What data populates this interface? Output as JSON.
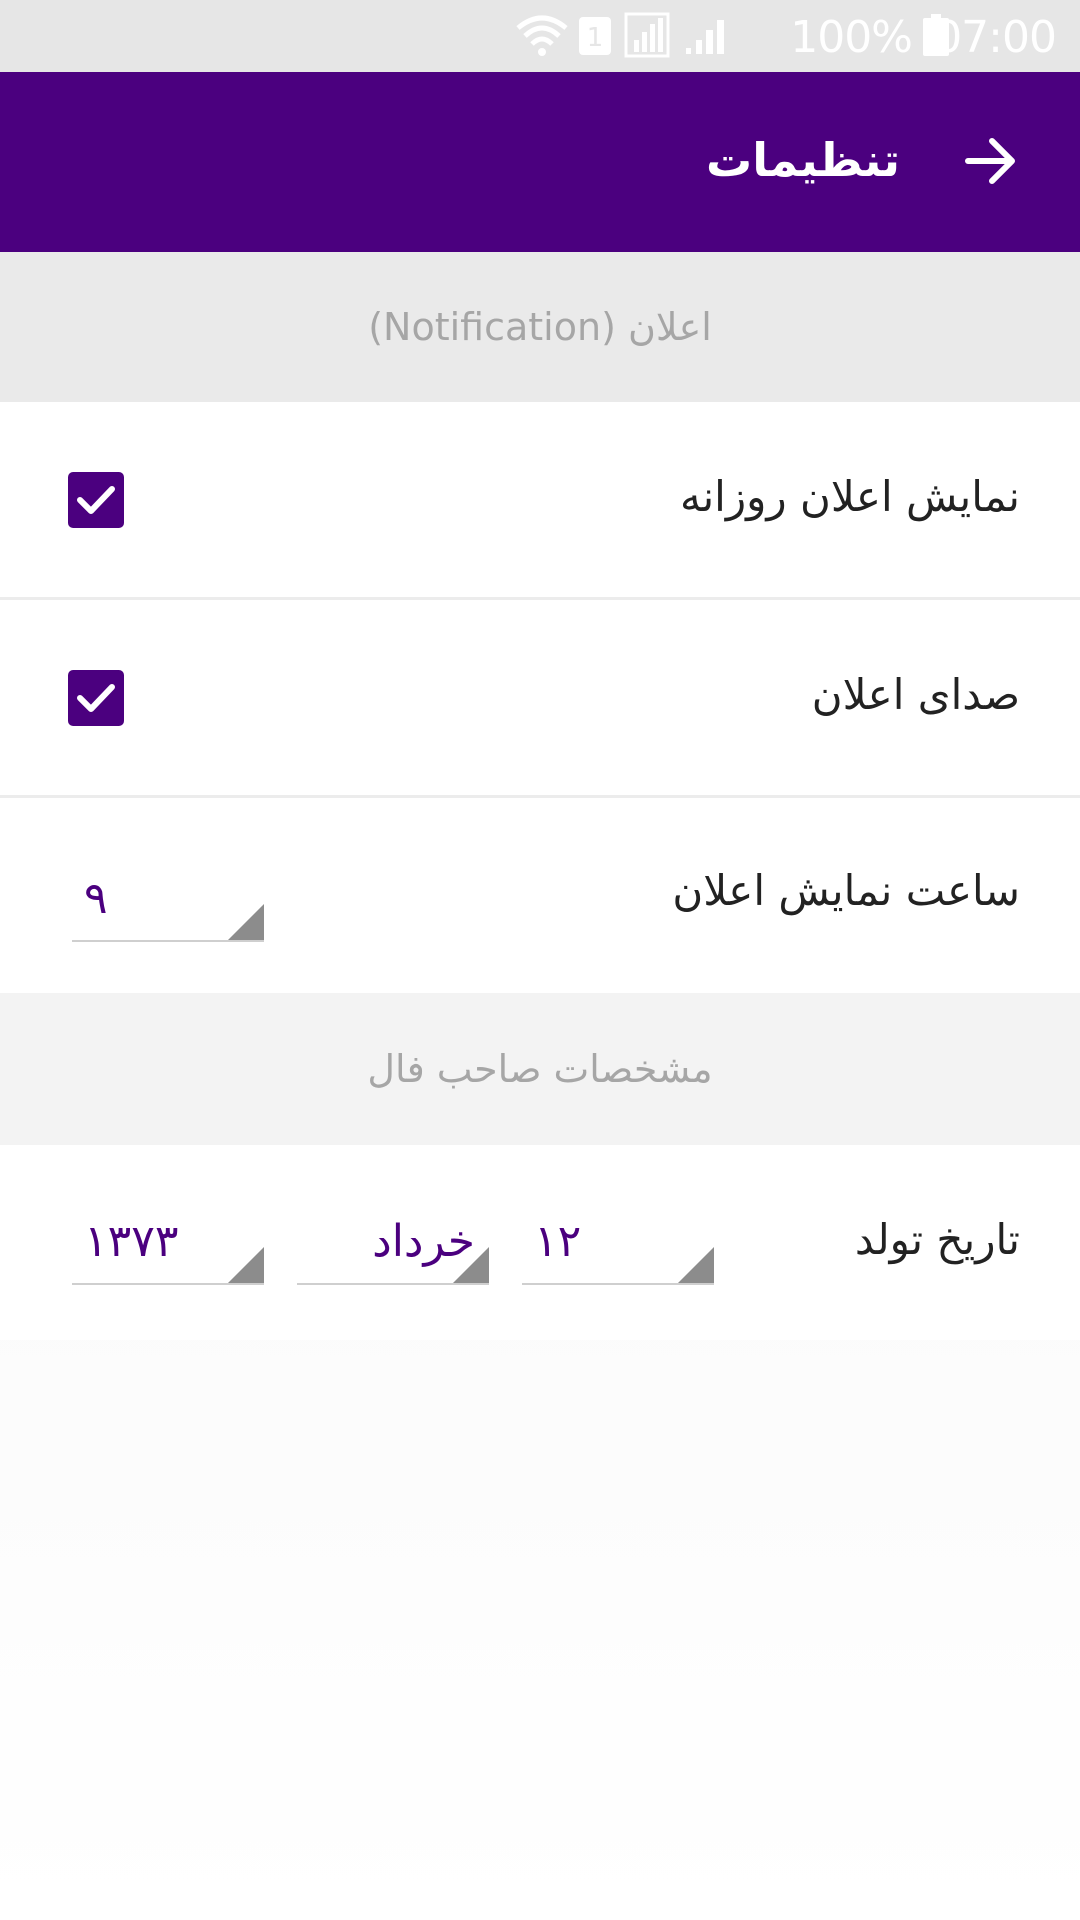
{
  "status_bar": {
    "time": "07:00",
    "battery_text": "100%",
    "icons": [
      "wifi-icon",
      "sim1-icon",
      "sim2-signal-icon",
      "signal-icon",
      "battery-icon"
    ]
  },
  "app_bar": {
    "title": "تنظیمات",
    "back_icon": "arrow-right-icon"
  },
  "sections": {
    "notification": {
      "header": "اعلان (Notification)",
      "daily_notification_label": "نمایش اعلان روزانه",
      "daily_notification_checked": true,
      "sound_label": "صدای اعلان",
      "sound_checked": true,
      "time_label": "ساعت نمایش اعلان",
      "time_value": "۹"
    },
    "owner": {
      "header": "مشخصات صاحب فال",
      "birthdate_label": "تاریخ تولد",
      "day_value": "۱۲",
      "month_value": "خرداد",
      "year_value": "۱۳۷۳"
    }
  },
  "colors": {
    "primary": "#4b007f",
    "section_header_bg": "#eaeaea",
    "section_header_text": "#a6a6a6"
  }
}
